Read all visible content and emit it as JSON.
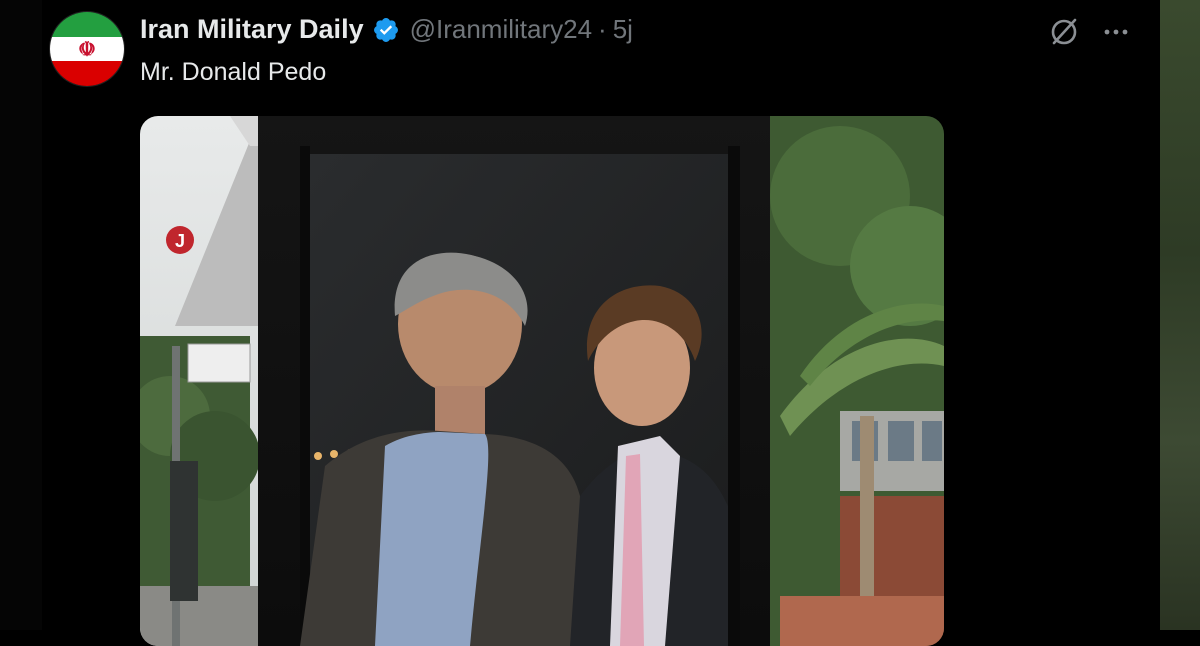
{
  "account": {
    "display_name": "Iran Military Daily",
    "handle": "@Iranmilitary24",
    "separator": "·",
    "time": "5j",
    "avatar_emblem": "☫",
    "avatar_colors": [
      "#239f40",
      "#ffffff",
      "#da0000"
    ]
  },
  "tweet": {
    "text": "Mr. Donald Pedo"
  },
  "icons": {
    "verified": "verified-badge-icon",
    "grok": "grok-icon",
    "more": "more-options-icon"
  },
  "colors": {
    "background": "#000000",
    "text_primary": "#e7e9ea",
    "text_secondary": "#71767b",
    "verified_blue": "#1d9bf0"
  },
  "media": {
    "sign_text": "J",
    "description": "photo"
  }
}
